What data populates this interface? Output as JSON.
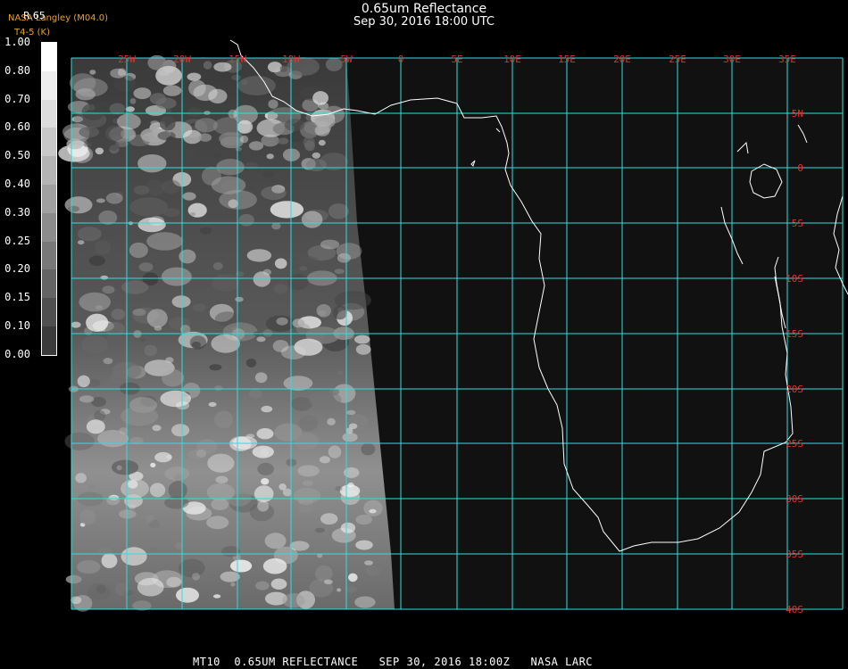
{
  "title": "0.65um Reflectance",
  "subtitle": "Sep 30, 2016 18:00 UTC",
  "credit_line1": "NASA Langley (M04.0)",
  "credit_line2": "T4-5 (K)",
  "colorbar": {
    "label": "R.65",
    "ticks": [
      "1.00",
      "0.80",
      "0.70",
      "0.60",
      "0.50",
      "0.40",
      "0.30",
      "0.25",
      "0.20",
      "0.15",
      "0.10",
      "0.00"
    ],
    "segment_colors": [
      "#ffffff",
      "#eeeeee",
      "#dcdcdc",
      "#c8c8c8",
      "#b4b4b4",
      "#a0a0a0",
      "#8c8c8c",
      "#787878",
      "#646464",
      "#505050",
      "#3c3c3c"
    ]
  },
  "lon_labels": [
    "25W",
    "20W",
    "15W",
    "10W",
    "5W",
    "0",
    "5E",
    "10E",
    "15E",
    "20E",
    "25E",
    "30E",
    "35E"
  ],
  "lat_labels": [
    "5N",
    "0",
    "5S",
    "10S",
    "15S",
    "20S",
    "25S",
    "30S",
    "35S",
    "40S"
  ],
  "footer": "MT10  0.65UM REFLECTANCE   SEP 30, 2016 18:00Z   NASA LARC",
  "colors": {
    "grid": "#2ee0e0",
    "labels": "#e03030",
    "credit": "#e8a030",
    "coast": "#ffffff"
  }
}
